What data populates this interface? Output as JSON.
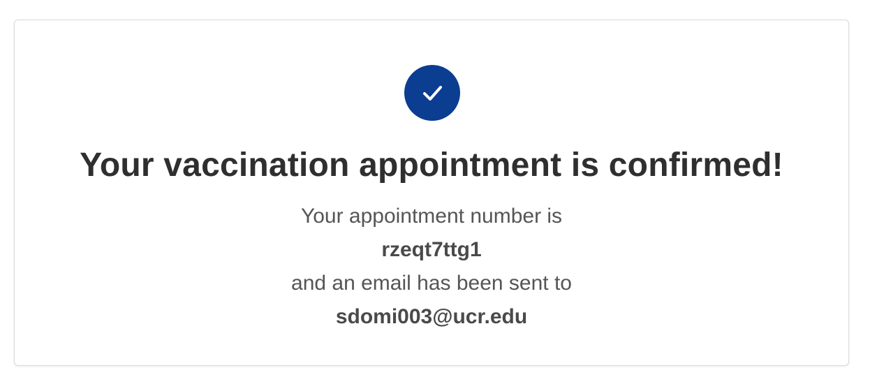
{
  "confirmation": {
    "icon": "check-icon",
    "accent_color": "#0b3d91",
    "title": "Your vaccination appointment is confirmed!",
    "number_intro": "Your appointment number is",
    "appointment_number": "rzeqt7ttg1",
    "email_intro": "and an email has been sent to",
    "email": "sdomi003@ucr.edu"
  }
}
